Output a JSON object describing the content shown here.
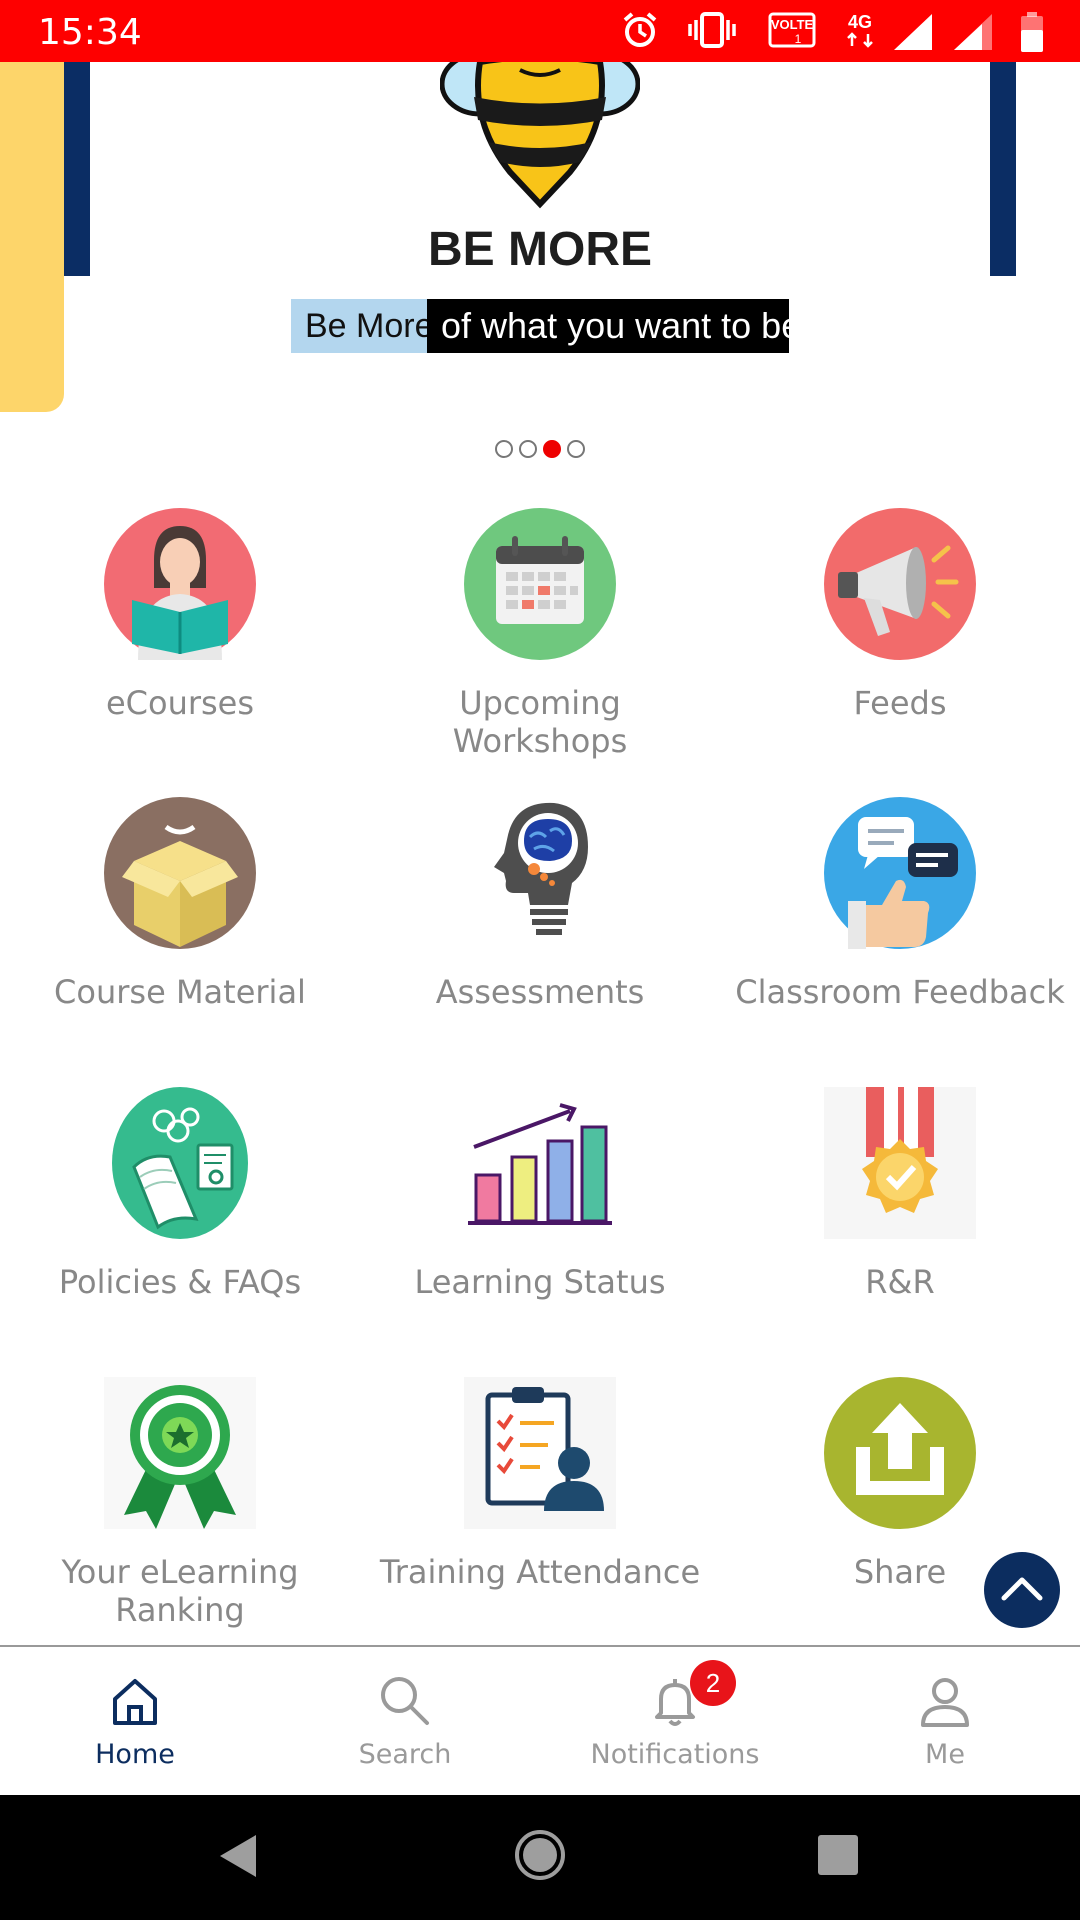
{
  "status_bar": {
    "time": "15:34",
    "volte": "VOLTE",
    "network": "4G",
    "sim": "1"
  },
  "banner": {
    "headline": "BE MORE",
    "tagline_highlight": "Be More",
    "tagline_rest": "of what you want to be",
    "slide_count": 4,
    "active_slide": 3
  },
  "tiles": [
    {
      "label": "eCourses",
      "icon": "reader-icon"
    },
    {
      "label": "Upcoming Workshops",
      "icon": "calendar-icon"
    },
    {
      "label": "Feeds",
      "icon": "megaphone-icon"
    },
    {
      "label": "Course Material",
      "icon": "box-icon"
    },
    {
      "label": "Assessments",
      "icon": "brain-bulb-icon"
    },
    {
      "label": "Classroom Feedback",
      "icon": "feedback-thumbs-up-icon"
    },
    {
      "label": "Policies & FAQs",
      "icon": "document-certificate-icon"
    },
    {
      "label": "Learning Status",
      "icon": "bar-chart-growth-icon"
    },
    {
      "label": "R&R",
      "icon": "medal-icon"
    },
    {
      "label": "Your eLearning Ranking",
      "icon": "award-ribbon-icon"
    },
    {
      "label": "Training Attendance",
      "icon": "clipboard-checklist-icon"
    },
    {
      "label": "Share",
      "icon": "upload-share-icon"
    }
  ],
  "bottom_nav": {
    "items": [
      {
        "label": "Home",
        "icon": "home-icon",
        "active": true
      },
      {
        "label": "Search",
        "icon": "search-icon",
        "active": false
      },
      {
        "label": "Notifications",
        "icon": "bell-icon",
        "active": false
      },
      {
        "label": "Me",
        "icon": "person-icon",
        "active": false
      }
    ],
    "notification_count": "2"
  },
  "colors": {
    "status_bar": "#fe0000",
    "navy": "#0c2d5f",
    "badge": "#e8141a",
    "label_grey": "#888888"
  }
}
